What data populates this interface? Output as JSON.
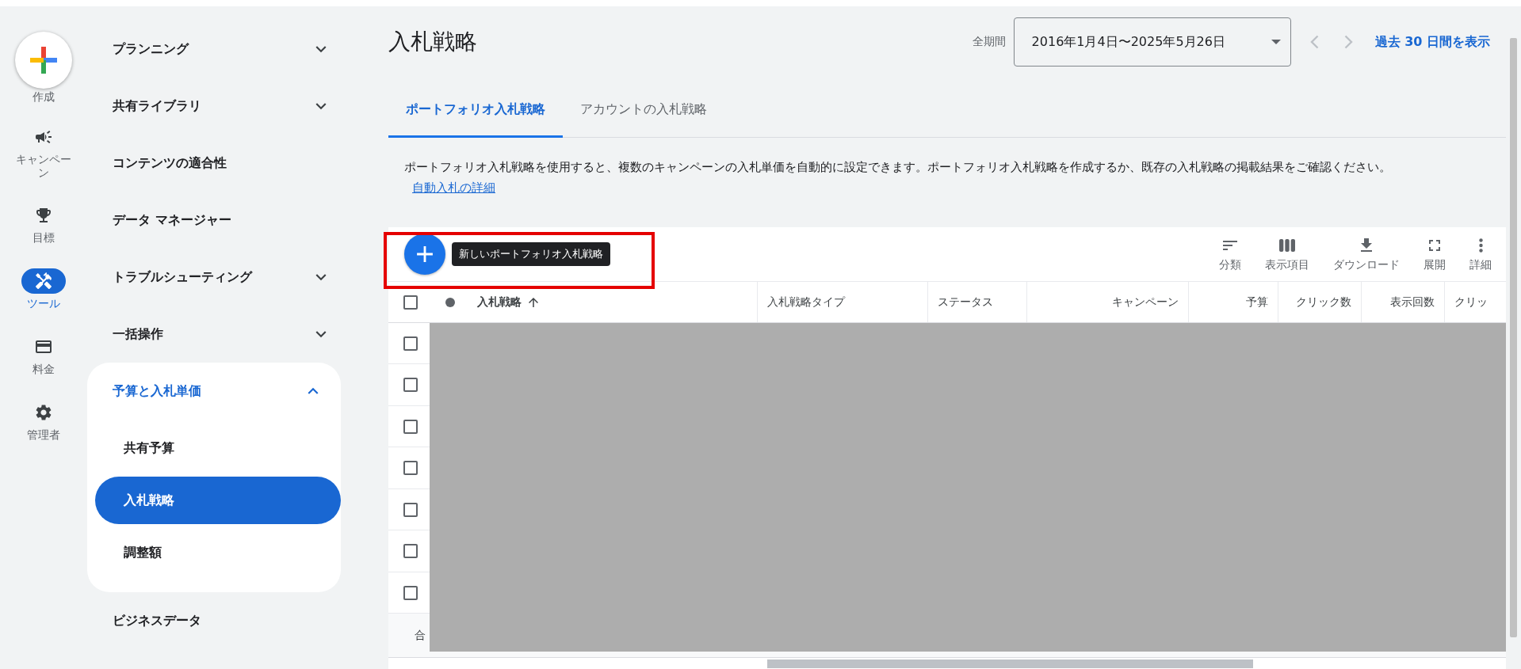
{
  "rail": [
    {
      "kind": "create",
      "label": "作成"
    },
    {
      "kind": "campaign",
      "label": "キャンペーン",
      "selected": false
    },
    {
      "kind": "goal",
      "label": "目標",
      "selected": false
    },
    {
      "kind": "tools",
      "label": "ツール",
      "selected": true
    },
    {
      "kind": "billing",
      "label": "料金",
      "selected": false
    },
    {
      "kind": "admin",
      "label": "管理者",
      "selected": false
    }
  ],
  "sidebar": {
    "items": [
      {
        "label": "プランニング",
        "expanded": false
      },
      {
        "label": "共有ライブラリ",
        "expanded": false
      },
      {
        "label": "コンテンツの適合性"
      },
      {
        "label": "データ マネージャー"
      },
      {
        "label": "トラブルシューティング",
        "expanded": false
      },
      {
        "label": "一括操作",
        "expanded": false
      },
      {
        "label": "予算と入札単価",
        "expanded": true,
        "children": [
          {
            "label": "共有予算",
            "selected": false
          },
          {
            "label": "入札戦略",
            "selected": true
          },
          {
            "label": "調整額",
            "selected": false
          }
        ]
      },
      {
        "label": "ビジネスデータ"
      }
    ]
  },
  "header": {
    "title": "入札戦略",
    "date_label": "全期間",
    "date_range": "2016年1月4日〜2025年5月26日",
    "link": "過去 30 日間を表示"
  },
  "tabs": [
    {
      "label": "ポートフォリオ入札戦略",
      "selected": true
    },
    {
      "label": "アカウントの入札戦略",
      "selected": false
    }
  ],
  "description": {
    "text": "ポートフォリオ入札戦略を使用すると、複数のキャンペーンの入札単価を自動的に設定できます。ポートフォリオ入札戦略を作成するか、既存の入札戦略の掲載結果をご確認ください。",
    "link": "自動入札の詳細"
  },
  "toolbar": {
    "add_tooltip": "新しいポートフォリオ入札戦略",
    "actions": [
      {
        "kind": "segment",
        "label": "分類"
      },
      {
        "kind": "columns",
        "label": "表示項目"
      },
      {
        "kind": "download",
        "label": "ダウンロード"
      },
      {
        "kind": "expand",
        "label": "展開"
      },
      {
        "kind": "more",
        "label": "詳細"
      }
    ]
  },
  "table": {
    "header_checked": false,
    "columns": [
      {
        "label": "入札戦略",
        "sorted": true
      },
      {
        "label": "入札戦略タイプ"
      },
      {
        "label": "ステータス"
      },
      {
        "label": "キャンペーン"
      },
      {
        "label": "予算"
      },
      {
        "label": "クリック数"
      },
      {
        "label": "表示回数"
      },
      {
        "label": "クリッ"
      }
    ],
    "rows": [
      {
        "checked": false
      },
      {
        "checked": false
      },
      {
        "checked": false
      },
      {
        "checked": false
      },
      {
        "checked": false
      },
      {
        "checked": false
      },
      {
        "checked": false
      }
    ],
    "total_label": "合"
  }
}
